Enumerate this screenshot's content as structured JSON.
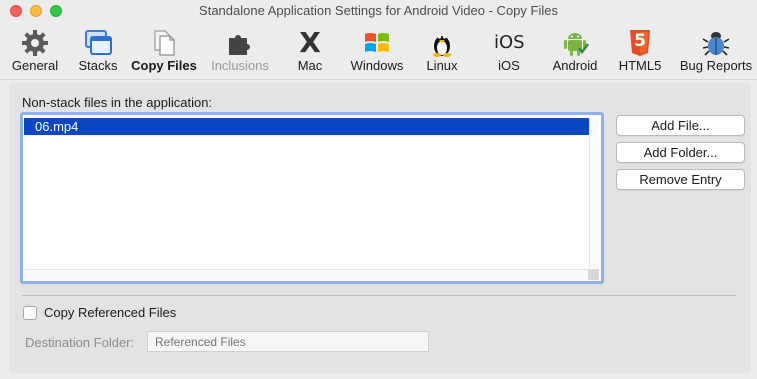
{
  "window": {
    "title": "Standalone Application Settings for Android Video - Copy Files"
  },
  "toolbar": {
    "items": [
      {
        "label": "General",
        "icon": "gear-icon"
      },
      {
        "label": "Stacks",
        "icon": "stacks-icon"
      },
      {
        "label": "Copy Files",
        "icon": "copy-files-icon",
        "state": "active"
      },
      {
        "label": "Inclusions",
        "icon": "puzzle-icon",
        "state": "disabled"
      },
      {
        "label": "Mac",
        "icon": "mac-x-icon"
      },
      {
        "label": "Windows",
        "icon": "windows-icon"
      },
      {
        "label": "Linux",
        "icon": "tux-icon"
      },
      {
        "label": "iOS",
        "icon": "ios-text-icon"
      },
      {
        "label": "Android",
        "icon": "android-icon"
      },
      {
        "label": "HTML5",
        "icon": "html5-icon"
      },
      {
        "label": "Bug Reports",
        "icon": "bug-icon"
      }
    ],
    "ios_icon_text": "iOS",
    "mac_icon_text": "X",
    "html5_icon_text": "5"
  },
  "files": {
    "label": "Non-stack files in the application:",
    "items": [
      "06.mp4"
    ],
    "selected_index": 0
  },
  "buttons": {
    "add_file": "Add File...",
    "add_folder": "Add Folder...",
    "remove_entry": "Remove Entry"
  },
  "options": {
    "copy_referenced_label": "Copy Referenced Files",
    "copy_referenced_checked": false,
    "destination_label": "Destination Folder:",
    "destination_placeholder": "Referenced Files"
  },
  "colors": {
    "selection": "#0a47c2",
    "focus_ring": "#8db0e8",
    "html5": "#e44d26",
    "android": "#7cb342"
  }
}
